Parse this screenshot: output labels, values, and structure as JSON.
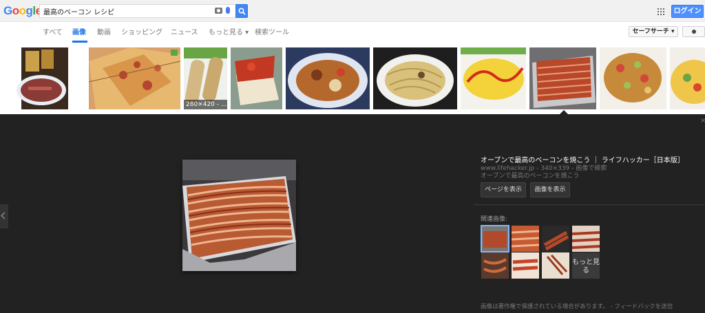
{
  "header": {
    "logo": [
      "G",
      "o",
      "o",
      "g",
      "l",
      "e"
    ],
    "logo_colors": [
      "#4285f4",
      "#ea4335",
      "#fbbc05",
      "#4285f4",
      "#34a853",
      "#ea4335"
    ],
    "search_value": "最高のベーコン レシピ",
    "login_label": "ログイン"
  },
  "tabs": {
    "items": [
      "すべて",
      "画像",
      "動画",
      "ショッピング",
      "ニュース",
      "もっと見る ▾",
      "検索ツール"
    ],
    "active": "画像",
    "safe_search": "セーフサーチ ▾"
  },
  "strip": {
    "size_label": "280×420 - ..."
  },
  "viewer": {
    "title": "オーブンで最高のベーコンを焼こう ｜ ライフハッカー［日本版］",
    "meta": "www.lifehacker.jp - 340×339 - 画像で検索",
    "description": "オーブンで最高のベーコンを焼こう",
    "view_page": "ページを表示",
    "view_image": "画像を表示",
    "related_label": "関連画像:",
    "more_label": "もっと見る",
    "footer": "画像は著作権で保護されている場合があります。 - フィードバックを送信"
  },
  "colors": {
    "accent": "#1a73e8",
    "login_blue": "#4d90fe",
    "viewer_bg": "#222222"
  }
}
